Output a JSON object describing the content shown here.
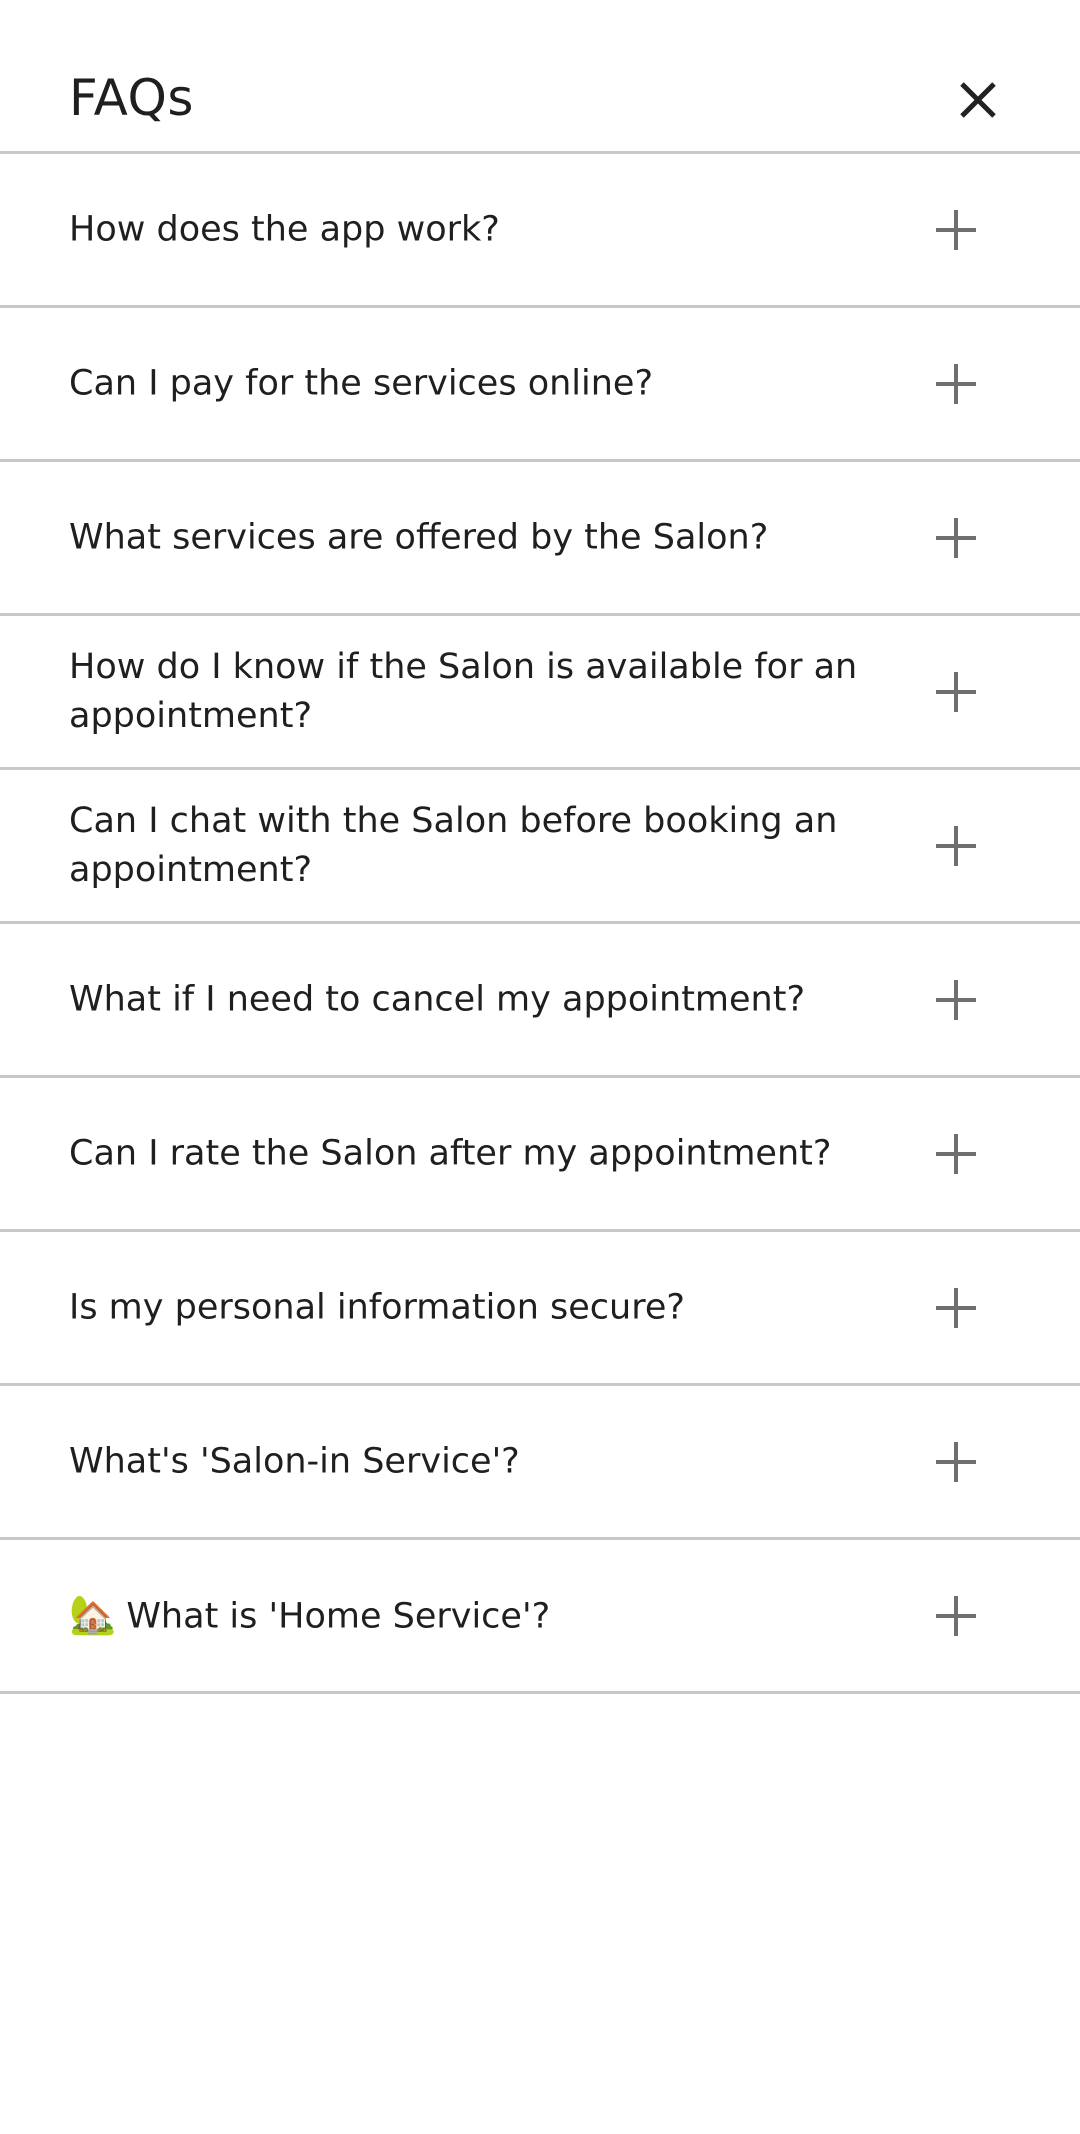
{
  "header": {
    "title": "FAQs",
    "close_icon": "close-icon"
  },
  "faqs": [
    {
      "question": "How does the app work?",
      "icon": "plus-icon"
    },
    {
      "question": "Can I pay for the services online?",
      "icon": "plus-icon"
    },
    {
      "question": "What services are offered by the Salon?",
      "icon": "plus-icon"
    },
    {
      "question": "How do I know if the Salon is available for an appointment?",
      "icon": "plus-icon"
    },
    {
      "question": "Can I chat with the Salon before booking an appointment?",
      "icon": "plus-icon"
    },
    {
      "question": "What if I need to cancel my appointment?",
      "icon": "plus-icon"
    },
    {
      "question": "Can I rate the Salon after my appointment?",
      "icon": "plus-icon"
    },
    {
      "question": "Is my personal information secure?",
      "icon": "plus-icon"
    },
    {
      "question": "What's 'Salon-in Service'?",
      "icon": "plus-icon"
    },
    {
      "emoji": "🏡",
      "question": "What is 'Home Service'?",
      "icon": "plus-icon"
    }
  ],
  "colors": {
    "text": "#1f1f1f",
    "divider": "#c8c8c8",
    "icon": "#6f6f6f",
    "background": "#ffffff"
  }
}
